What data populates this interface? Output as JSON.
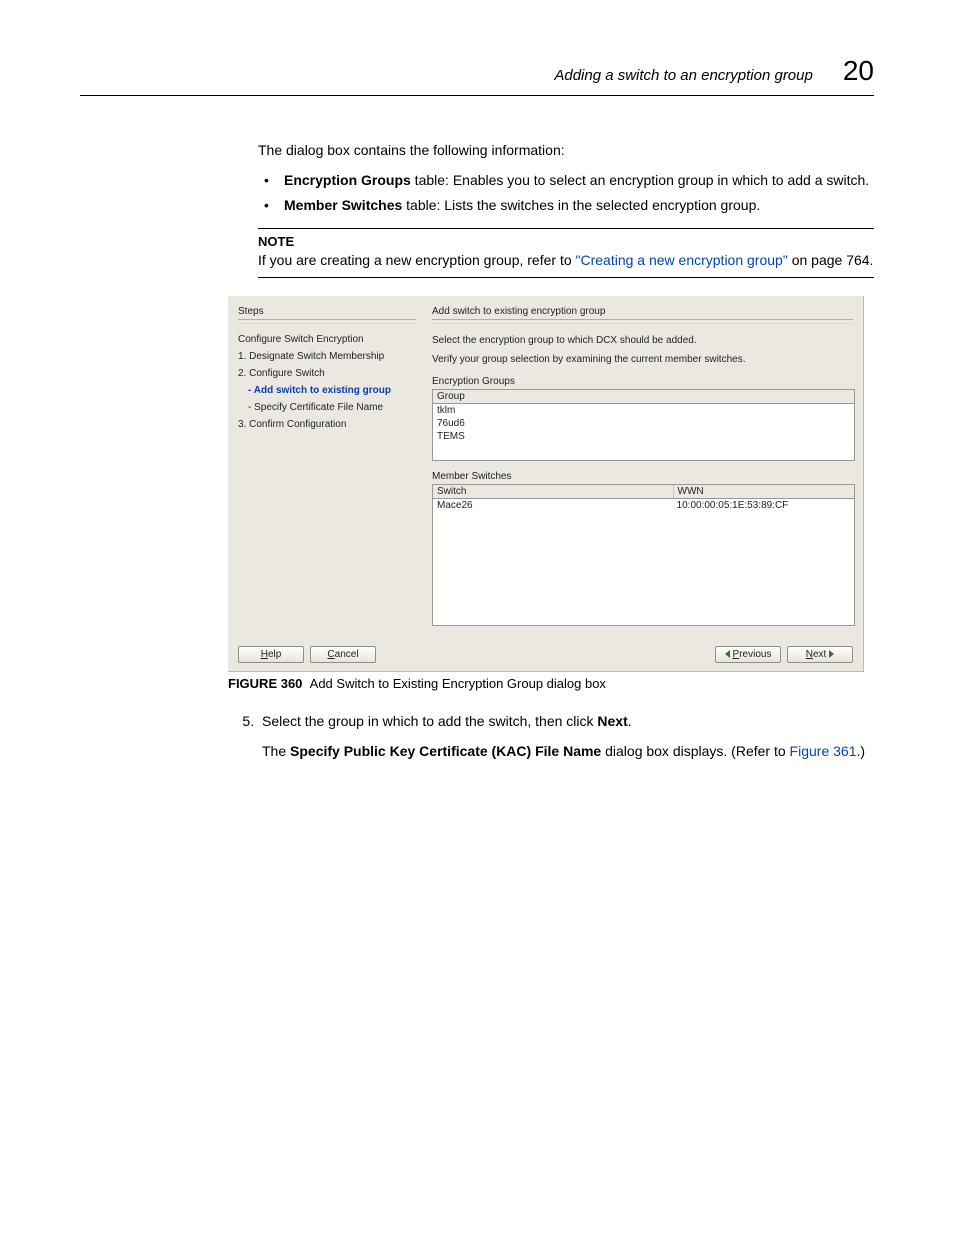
{
  "header": {
    "title": "Adding a switch to an encryption group",
    "chapter_number": "20"
  },
  "intro": "The dialog box contains the following information:",
  "bullets": [
    {
      "bold": "Encryption Groups",
      "rest": " table: Enables you to select an encryption group in which to add a switch."
    },
    {
      "bold": "Member Switches",
      "rest": " table: Lists the switches in the selected encryption group."
    }
  ],
  "note": {
    "label": "NOTE",
    "pre": "If you are creating a new encryption group, refer to ",
    "link": "\"Creating a new encryption group\"",
    "post": " on page 764."
  },
  "dialog": {
    "steps_label": "Steps",
    "steps_heading": "Configure Switch Encryption",
    "step1": "1. Designate Switch Membership",
    "step2": "2. Configure Switch",
    "step2a": "- Add switch to existing group",
    "step2b": "- Specify Certificate File Name",
    "step3": "3. Confirm Configuration",
    "right_title": "Add switch to existing encryption group",
    "instr1": "Select the encryption group to which DCX should be added.",
    "instr2": "Verify your group selection by examining the current member switches.",
    "groups_label": "Encryption Groups",
    "groups_header": "Group",
    "groups": [
      "tklm",
      "76ud6",
      "TEMS"
    ],
    "members_label": "Member Switches",
    "members_h1": "Switch",
    "members_h2": "WWN",
    "members": [
      {
        "switch": "Mace26",
        "wwn": "10:00:00:05:1E:53:89:CF"
      }
    ],
    "btn_help": "Help",
    "btn_cancel": "Cancel",
    "btn_prev": "Previous",
    "btn_next": "Next"
  },
  "figure": {
    "num": "FIGURE 360",
    "caption": "Add Switch to Existing Encryption Group dialog box"
  },
  "step5": {
    "num": "5.",
    "text_pre": "Select the group in which to add the switch, then click ",
    "text_bold": "Next",
    "text_post": "."
  },
  "after": {
    "pre": "The ",
    "bold": "Specify Public Key Certificate (KAC) File Name",
    "mid": " dialog box displays. (Refer to ",
    "link": "Figure 361",
    "post": ".)"
  }
}
